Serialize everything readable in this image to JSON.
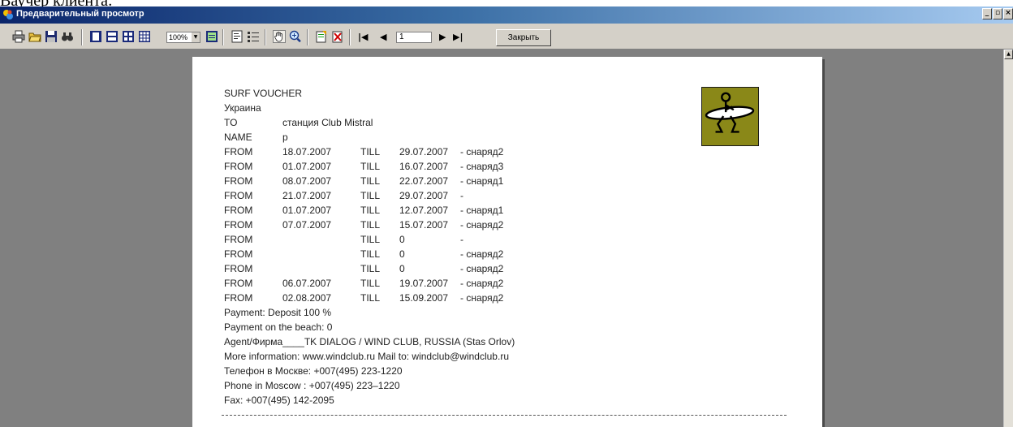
{
  "cropped_top_text": "Ваучер клиента:",
  "window": {
    "title": "Предварительный просмотр",
    "controls": [
      "_",
      "▫",
      "×"
    ]
  },
  "toolbar": {
    "zoom_value": "100%",
    "page_number": "1",
    "close_label": "Закрыть"
  },
  "document": {
    "heading": "SURF VOUCHER",
    "country": "Украина",
    "to_label": "TO",
    "to_value": "станция Club Mistral",
    "name_label": "NAME",
    "name_value": "p",
    "from_label": "FROM",
    "till_label": "TILL",
    "rows": [
      {
        "from": "18.07.2007",
        "till": "29.07.2007",
        "note": "- снаряд2"
      },
      {
        "from": "01.07.2007",
        "till": "16.07.2007",
        "note": "- снаряд3"
      },
      {
        "from": "08.07.2007",
        "till": "22.07.2007",
        "note": "- снаряд1"
      },
      {
        "from": "21.07.2007",
        "till": "29.07.2007",
        "note": "-"
      },
      {
        "from": "01.07.2007",
        "till": "12.07.2007",
        "note": "- снаряд1"
      },
      {
        "from": "07.07.2007",
        "till": "15.07.2007",
        "note": "- снаряд2"
      },
      {
        "from": "",
        "till": "0",
        "note": "-"
      },
      {
        "from": "",
        "till": "0",
        "note": "- снаряд2"
      },
      {
        "from": "",
        "till": "0",
        "note": "- снаряд2"
      },
      {
        "from": "06.07.2007",
        "till": "19.07.2007",
        "note": "- снаряд2"
      },
      {
        "from": "02.08.2007",
        "till": "15.09.2007",
        "note": "- снаряд2"
      }
    ],
    "payment": "Payment: Deposit  100 %",
    "payment_beach": "Payment on the beach:   0",
    "agent": "Agent/Фирма____TK DIALOG / WIND CLUB, RUSSIA (Stas Orlov)",
    "more_info": "More information: www.windclub.ru Mail to:  windclub@windclub.ru",
    "phone_ru": "Телефон в Москве: +007(495) 223-1220",
    "phone_en": "Phone in Moscow : +007(495) 223–1220",
    "fax": "Fax: +007(495) 142-2095"
  },
  "colors": {
    "titlebar_start": "#0a246a",
    "titlebar_end": "#a6caf0",
    "toolbar_bg": "#d4d0c8",
    "preview_bg": "#808080",
    "logo_bg": "#8a8818"
  },
  "icons": [
    "print-icon",
    "open-icon",
    "save-icon",
    "find-icon",
    "one-page-icon",
    "two-pages-icon",
    "four-pages-icon",
    "multi-pages-icon",
    "page-width-icon",
    "outline-icon",
    "thumbnails-icon",
    "hand-icon",
    "zoom-icon",
    "edit-icon",
    "delete-page-icon",
    "first-page-icon",
    "prev-page-icon",
    "next-page-icon",
    "last-page-icon"
  ]
}
